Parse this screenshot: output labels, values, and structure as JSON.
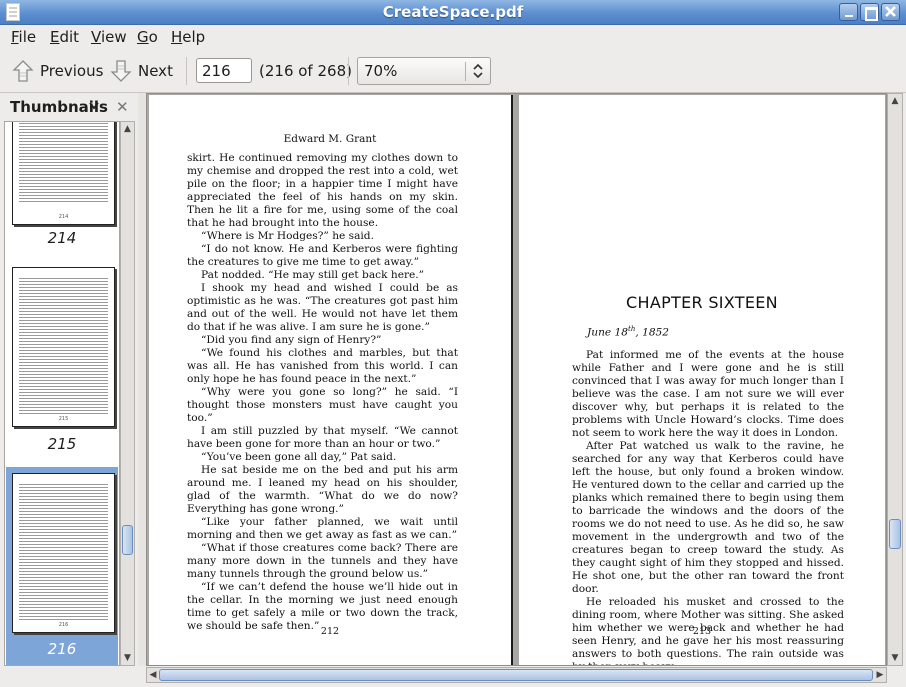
{
  "window": {
    "title": "CreateSpace.pdf"
  },
  "menu": [
    {
      "first": "F",
      "rest": "ile"
    },
    {
      "first": "E",
      "rest": "dit"
    },
    {
      "first": "V",
      "rest": "iew"
    },
    {
      "first": "G",
      "rest": "o"
    },
    {
      "first": "H",
      "rest": "elp"
    }
  ],
  "toolbar": {
    "previous_label": "Previous",
    "next_label": "Next",
    "page_value": "216",
    "page_count": "(216 of 268)",
    "zoom_value": "70%"
  },
  "sidebar": {
    "title": "Thumbnails",
    "thumbnails": [
      {
        "label": "214",
        "page_num": "214"
      },
      {
        "label": "215",
        "page_num": "215"
      },
      {
        "label": "216",
        "page_num": "216"
      }
    ]
  },
  "pages": {
    "left": {
      "running_head": "Edward M. Grant",
      "folio": "212",
      "paragraphs": [
        "skirt. He continued removing my clothes down to my chemise and dropped the rest into a cold, wet pile on the floor; in a happier time I might have appreciated the feel of his hands on my skin. Then he lit a fire for me, using some of the coal that he had brought into the house.",
        "“Where is Mr Hodges?” he said.",
        "“I do not know. He and Kerberos were fighting the creatures to give me time to get away.”",
        "Pat nodded. “He may still get back here.”",
        "I shook my head and wished I could be as optimistic as he was. “The creatures got past him and out of the well. He would not have let them do that if he was alive. I am sure he is gone.”",
        "“Did you find any sign of Henry?”",
        "“We found his clothes and marbles, but that was all. He has vanished from this world. I can only hope he has found peace in the next.”",
        "“Why were you gone so long?” he said. “I thought those monsters must have caught you too.”",
        "I am still puzzled by that myself. “We cannot have been gone for more than an hour or two.”",
        "“You’ve been gone all day,” Pat said.",
        "He sat beside me on the bed and put his arm around me. I leaned my head on his shoulder, glad of the warmth. “What do we do now? Everything has gone wrong.”",
        "“Like your father planned, we wait until morning and then we get away as fast as we can.”",
        "“What if those creatures come back? There are many more down in the tunnels and they have many tunnels through the ground below us.”",
        "“If we can’t defend the house we’ll hide out in the cellar. In the morning we just need enough time to get safely a mile or two down the track, we should be safe then.”"
      ]
    },
    "right": {
      "chapter": "CHAPTER SIXTEEN",
      "date_main": "June 18",
      "date_sup": "th",
      "date_year": ", 1852",
      "folio": "213",
      "paragraphs": [
        "Pat informed me of the events at the house while Father and I were gone and he is still convinced that I was away for much longer than I believe was the case. I am not sure we will ever discover why, but perhaps it is related to the problems with Uncle Howard’s clocks. Time does not seem to work here the way it does in London.",
        "After Pat watched us walk to the ravine, he searched for any way that Kerberos could have left the house, but only found a  broken window. He ventured down to the cellar and carried up the planks which remained there to begin using them to barricade the windows and the doors of the rooms we do not need to use. As he did so, he saw movement in the undergrowth and two of the creatures began to creep toward the study. As they caught sight of him they stopped and hissed. He shot one, but the other ran toward the front door.",
        "He reloaded his musket and crossed to the dining room, where Mother was sitting. She asked him whether we were back and whether he had seen Henry, and he gave her his most reassuring answers to both questions. The rain outside was by then very heavy."
      ]
    }
  },
  "colors": {
    "titlebar": "#5d8fd0",
    "selection": "#7ea5d8",
    "scroll_grip": "#aac2e4"
  }
}
